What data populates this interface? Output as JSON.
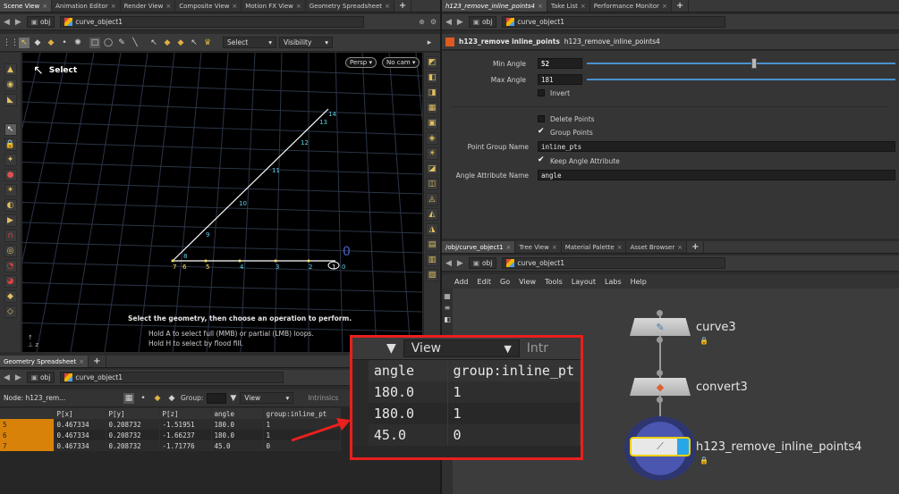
{
  "left_tabs": [
    "Scene View",
    "Animation Editor",
    "Render View",
    "Composite View",
    "Motion FX View",
    "Geometry Spreadsheet"
  ],
  "right_tabs": [
    "h123_remove_inline_points4",
    "Take List",
    "Performance Monitor"
  ],
  "path": {
    "context": "obj",
    "object": "curve_object1"
  },
  "viewport": {
    "select_label": "Select",
    "select_dropdown": "Select",
    "visibility_dropdown": "Visibility",
    "persp": "Persp",
    "cam": "No cam",
    "axis_zero": "0",
    "hint_main": "Select the geometry, then choose an operation to perform.",
    "hint_1": "Hold A to select full (MMB) or partial (LMB) loops.",
    "hint_2": "Hold H to select by flood fill.",
    "diag_labels": [
      "8",
      "9",
      "10",
      "11",
      "12",
      "13",
      "14"
    ],
    "axis_labels": [
      "7",
      "6",
      "5",
      "4",
      "3",
      "2",
      "1",
      "0"
    ]
  },
  "params": {
    "node_type": "h123_remove inline_points",
    "node_name": "h123_remove_inline_points4",
    "min_angle_label": "Min Angle",
    "min_angle": "52",
    "max_angle_label": "Max Angle",
    "max_angle": "181",
    "invert": "Invert",
    "delete_points": "Delete Points",
    "group_points": "Group Points",
    "point_group_label": "Point Group Name",
    "point_group_value": "inline_pts",
    "keep_angle": "Keep Angle Attribute",
    "angle_attr_label": "Angle Attribute Name",
    "angle_attr_value": "angle"
  },
  "network_tabs": [
    "/obj/curve_object1",
    "Tree View",
    "Material Palette",
    "Asset Browser"
  ],
  "network_menu": [
    "Add",
    "Edit",
    "Go",
    "View",
    "Tools",
    "Layout",
    "Labs",
    "Help"
  ],
  "nodes": [
    {
      "name": "curve3"
    },
    {
      "name": "convert3"
    },
    {
      "name": "h123_remove_inline_points4"
    }
  ],
  "spreadsheet": {
    "tab": "Geometry Spreadsheet",
    "node_label": "Node: h123_rem...",
    "group_label": "Group:",
    "view_label": "View",
    "intrinsics_label": "Intrinsics",
    "columns": [
      "",
      "P[x]",
      "P[y]",
      "P[z]",
      "angle",
      "group:inline_pt"
    ],
    "rows": [
      [
        "5",
        "0.467334",
        "0.208732",
        "-1.51951",
        "180.0",
        "1"
      ],
      [
        "6",
        "0.467334",
        "0.208732",
        "-1.66237",
        "180.0",
        "1"
      ],
      [
        "7",
        "0.467334",
        "0.208732",
        "-1.71776",
        "45.0",
        "0"
      ]
    ]
  },
  "zoom": {
    "view": "View",
    "intr": "Intr",
    "columns": [
      "angle",
      "group:inline_pt"
    ],
    "rows": [
      [
        "180.0",
        "1"
      ],
      [
        "180.0",
        "1"
      ],
      [
        "45.0",
        "0"
      ]
    ]
  }
}
